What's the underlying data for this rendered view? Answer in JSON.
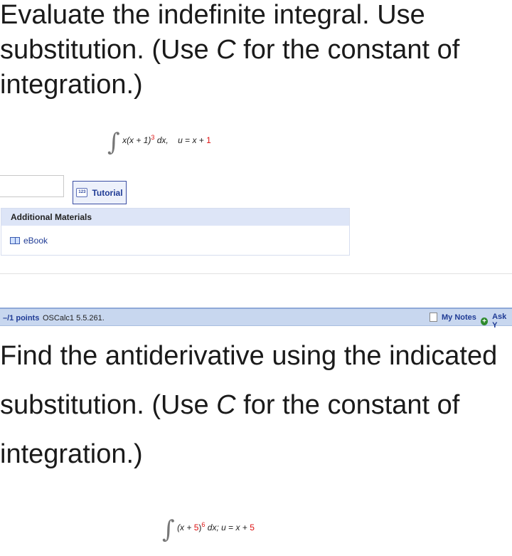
{
  "question1": {
    "line1": "Evaluate the indefinite integral. Use",
    "line2a": "substitution. (Use ",
    "line2b": "C",
    "line2c": " for the constant of",
    "line3": "integration.)",
    "integral": {
      "sign": "∫",
      "expr_a": "x(x + 1)",
      "power": "3",
      "expr_b": " dx,",
      "sub_a": "u",
      "sub_b": " = ",
      "sub_c": "x",
      "sub_d": " + ",
      "sub_e": "1"
    },
    "answer_value": "",
    "tutorial_icon": "123",
    "tutorial_label": "Tutorial",
    "additional_materials_label": "Additional Materials",
    "ebook_label": "eBook"
  },
  "points_bar": {
    "points": "–/1 points",
    "course_ref": "OSCalc1 5.5.261.",
    "my_notes": "My Notes",
    "plus": "+",
    "ask": "Ask Y"
  },
  "question2": {
    "line1": "Find the antiderivative using the indicated",
    "line2a": "substitution. (Use ",
    "line2b": "C",
    "line2c": " for the constant of",
    "line3": "integration.)",
    "integral": {
      "sign": "∫",
      "expr_a": "(x + ",
      "expr_b": "5",
      "expr_c": ")",
      "power": "6",
      "expr_d": " dx; ",
      "sub_a": "u",
      "sub_b": " = ",
      "sub_c": "x",
      "sub_d": " + ",
      "sub_e": "5"
    }
  },
  "colors": {
    "accent": "#1f3b95",
    "highlight_red": "#d11111",
    "bar_bg": "#c8d7ef"
  }
}
